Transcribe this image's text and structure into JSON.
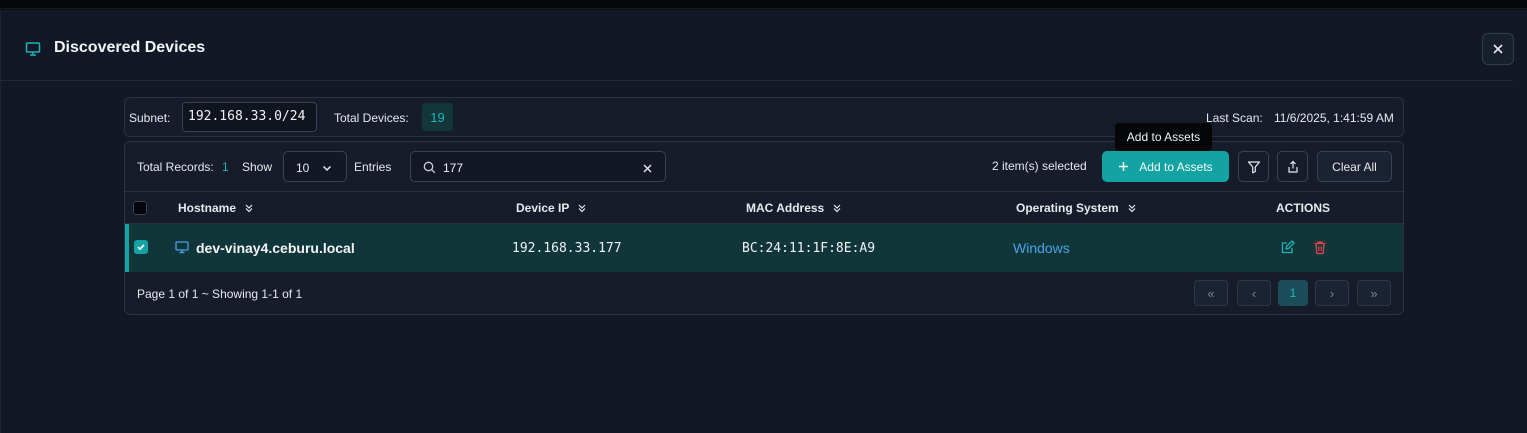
{
  "modal": {
    "title": "Discovered Devices",
    "close_icon": "close-icon",
    "header_icon": "monitor-icon"
  },
  "subnet_bar": {
    "subnet_label": "Subnet:",
    "subnet_value": "192.168.33.0/24",
    "total_devices_label": "Total Devices:",
    "total_devices_value": "19",
    "last_scan_label": "Last Scan:",
    "last_scan_value": "11/6/2025, 1:41:59 AM"
  },
  "toolbar": {
    "total_records_label": "Total Records:",
    "total_records_value": "1",
    "show_label": "Show",
    "entries_value": "10",
    "entries_label": "Entries",
    "search_value": "177",
    "selected_text": "2 item(s) selected",
    "add_button_label": "Add to Assets",
    "clear_all_label": "Clear All",
    "icons": [
      "search-icon",
      "close-icon",
      "plus-icon",
      "filter-icon",
      "export-icon"
    ]
  },
  "tooltip": {
    "text": "Add to Assets"
  },
  "table": {
    "columns": [
      {
        "label": "Hostname"
      },
      {
        "label": "Device IP"
      },
      {
        "label": "MAC Address"
      },
      {
        "label": "Operating System"
      },
      {
        "label": "ACTIONS"
      }
    ],
    "rows": [
      {
        "hostname": "dev-vinay4.ceburu.local",
        "device_ip": "192.168.33.177",
        "mac": "BC:24:11:1F:8E:A9",
        "os": "Windows",
        "selected": true
      }
    ]
  },
  "pagination": {
    "info": "Page 1 of 1 ~ Showing 1-1 of 1",
    "first": "«",
    "prev": "‹",
    "current": "1",
    "next": "›",
    "last": "»"
  },
  "colors": {
    "accent": "#14a3a3",
    "background": "#121826",
    "row_selected": "#10363a",
    "link": "#4aa3e6",
    "delete": "#e0454f"
  }
}
